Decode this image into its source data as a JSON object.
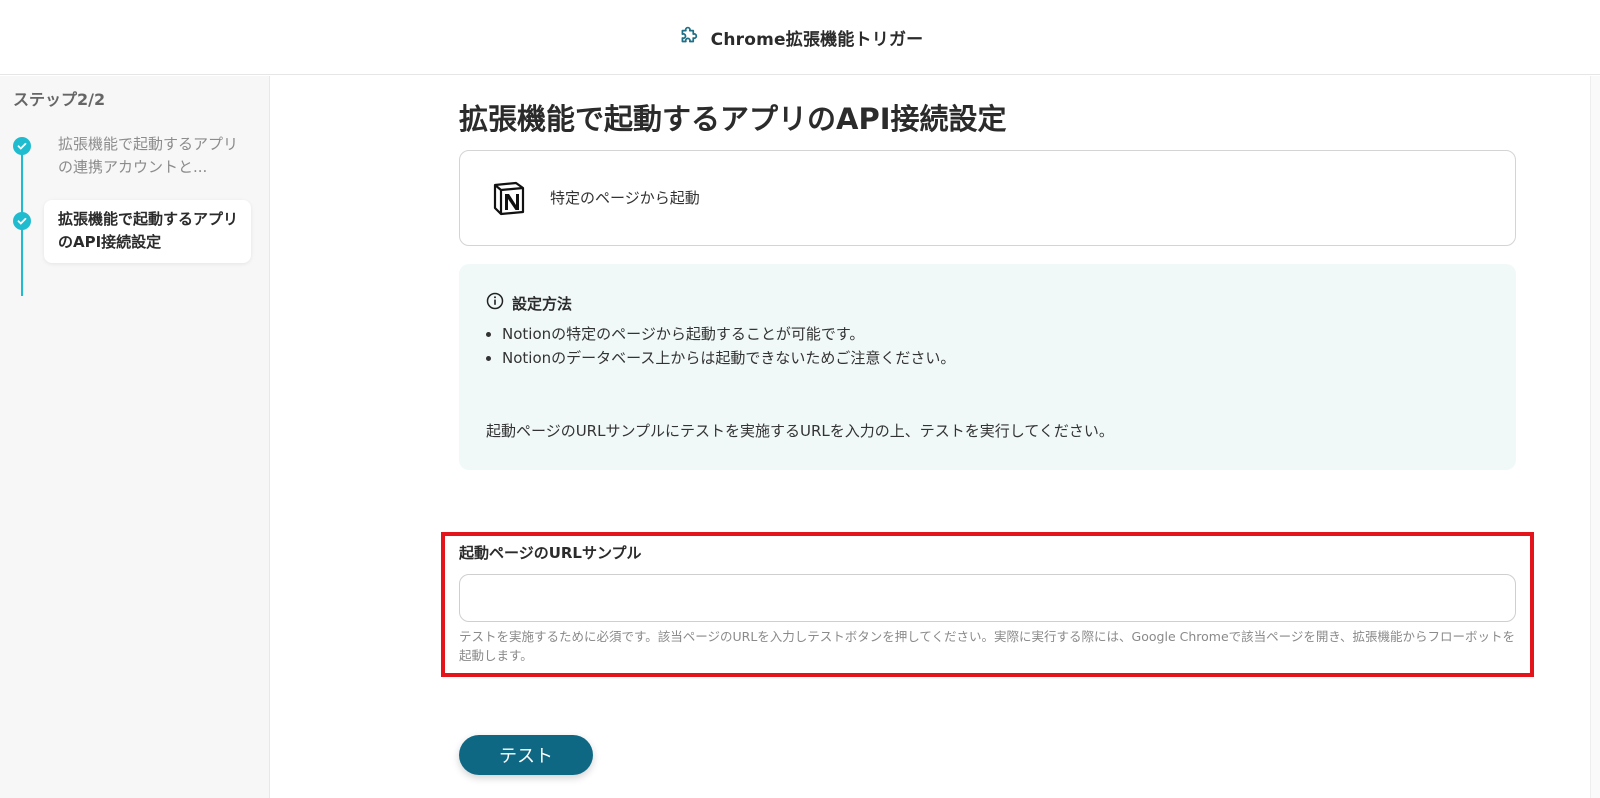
{
  "header": {
    "title": "Chrome拡張機能トリガー",
    "icon": "puzzle-icon"
  },
  "sidebar": {
    "step_count": "ステップ2/2",
    "steps": [
      {
        "label": "拡張機能で起動するアプリの連携アカウントと...",
        "status": "done"
      },
      {
        "label": "拡張機能で起動するアプリのAPI接続設定",
        "status": "current"
      }
    ]
  },
  "main": {
    "title": "拡張機能で起動するアプリのAPI接続設定",
    "trigger": {
      "app_icon": "notion-logo",
      "label": "特定のページから起動"
    },
    "info": {
      "title": "設定方法",
      "items": [
        "Notionの特定のページから起動することが可能です。",
        "Notionのデータベース上からは起動できないためご注意ください。"
      ],
      "note": "起動ページのURLサンプルにテストを実施するURLを入力の上、テストを実行してください。"
    },
    "url_field": {
      "label": "起動ページのURLサンプル",
      "value": "",
      "placeholder": "",
      "help": "テストを実施するために必須です。該当ページのURLを入力しテストボタンを押してください。実際に実行する際には、Google Chromeで該当ページを開き、拡張機能からフローボットを起動します。"
    },
    "test_button": "テスト"
  },
  "colors": {
    "accent": "#1fbcd0",
    "button": "#0e6884",
    "highlight": "#e3141c",
    "info_bg": "#f1f9f8"
  }
}
